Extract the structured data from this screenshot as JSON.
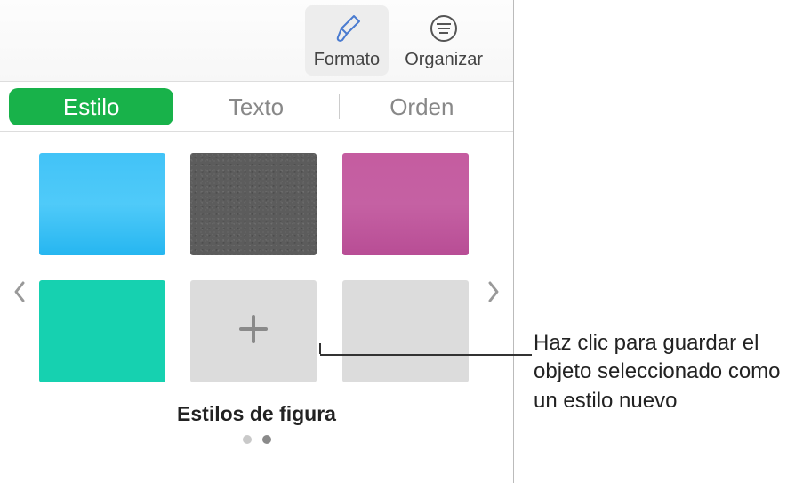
{
  "toolbar": {
    "format_label": "Formato",
    "organize_label": "Organizar"
  },
  "tabs": {
    "style": "Estilo",
    "text": "Texto",
    "order": "Orden"
  },
  "styles": {
    "section_title": "Estilos de figura",
    "swatches": [
      {
        "name": "blue-gradient"
      },
      {
        "name": "gray-texture"
      },
      {
        "name": "magenta-gradient"
      },
      {
        "name": "teal-solid"
      },
      {
        "name": "add-style"
      },
      {
        "name": "empty-slot"
      }
    ]
  },
  "callout": {
    "text": "Haz clic para guardar el objeto seleccionado como un estilo nuevo"
  }
}
